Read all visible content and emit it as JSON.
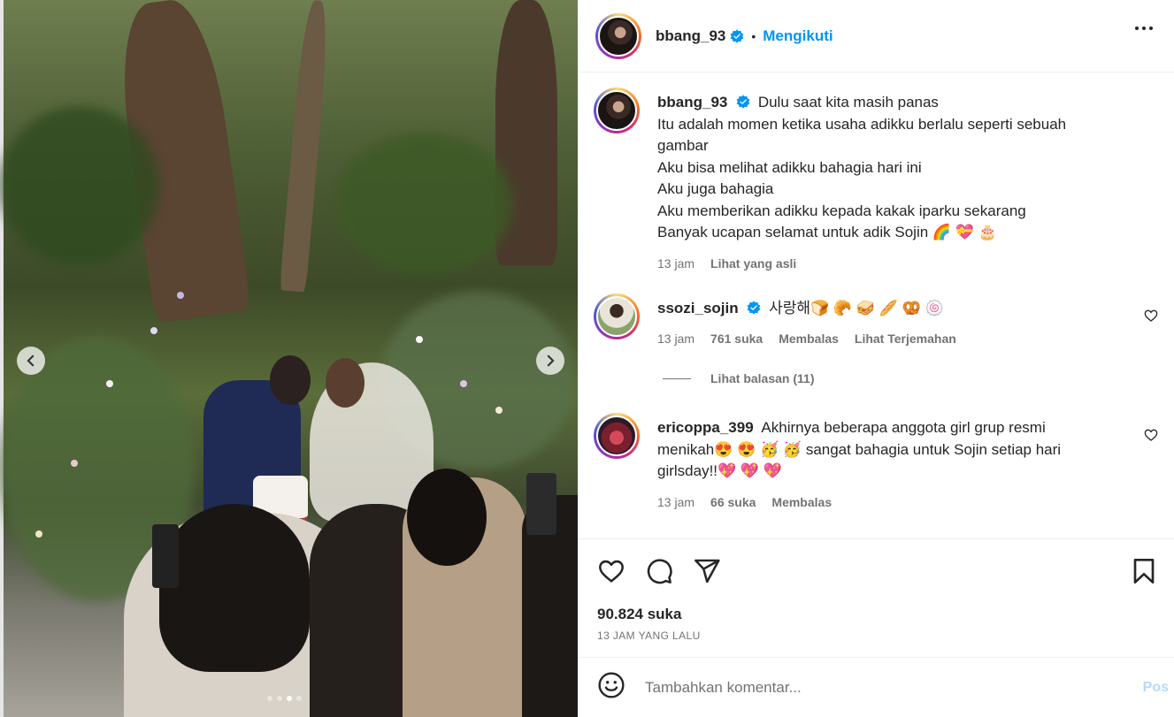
{
  "post": {
    "username": "bbang_93",
    "follow_label": "Mengikuti",
    "separator": "•",
    "caption_lines": [
      "Dulu saat kita masih panas",
      "Itu adalah momen ketika usaha adikku berlalu seperti sebuah",
      "gambar",
      "Aku bisa melihat adikku bahagia hari ini",
      "Aku juga bahagia",
      "Aku memberikan adikku kepada kakak iparku sekarang",
      "Banyak ucapan selamat untuk adik Sojin 🌈 💝 🎂"
    ],
    "caption_time": "13 jam",
    "see_original": "Lihat yang asli",
    "likes": "90.824 suka",
    "time_ago": "13 JAM YANG LALU",
    "carousel": {
      "count": 4,
      "active": 2
    }
  },
  "comments": [
    {
      "username": "ssozi_sojin",
      "verified": true,
      "text": "사랑해🍞 🥐 🥪 🥖 🥨 🍥",
      "time": "13 jam",
      "likes": "761 suka",
      "reply": "Membalas",
      "translate": "Lihat Terjemahan",
      "view_replies": "Lihat balasan (11)"
    },
    {
      "username": "ericoppa_399",
      "verified": false,
      "text_lines": [
        "Akhirnya beberapa anggota girl grup resmi",
        "menikah😍 😍 🥳 🥳  sangat bahagia untuk Sojin setiap hari",
        "girlsday!!💖 💖 💖"
      ],
      "time": "13 jam",
      "likes": "66 suka",
      "reply": "Membalas"
    }
  ],
  "add_comment": {
    "placeholder": "Tambahkan komentar...",
    "post_label": "Pos"
  },
  "colors": {
    "accent": "#0095f6",
    "muted": "#737373",
    "text": "#262626",
    "post_disabled": "#b3dbff"
  }
}
